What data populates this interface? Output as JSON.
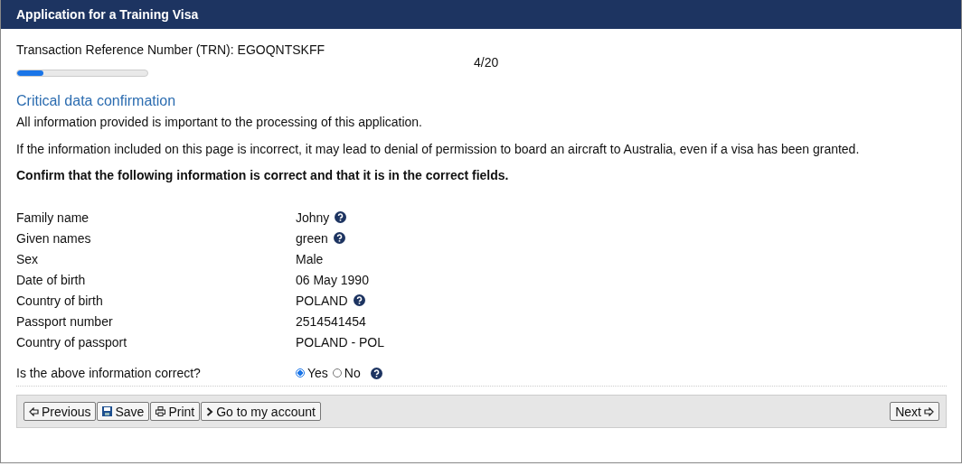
{
  "window": {
    "title": "Application for a Training Visa"
  },
  "trn": "Transaction Reference Number (TRN): EGOQNTSKFF",
  "progress": {
    "label": "4/20",
    "level": 0.2
  },
  "section": {
    "heading": "Critical data confirmation",
    "paragraphs": [
      "All information provided is important to the processing of this application.",
      "If the information included on this page is incorrect, it may lead to denial of permission to board an aircraft to Australia, even if a visa has been granted."
    ],
    "instruction": "Confirm that the following information is correct and that it is in the correct fields."
  },
  "fields": [
    {
      "label": "Family name",
      "value": "Johny",
      "help": true
    },
    {
      "label": "Given names",
      "value": "green",
      "help": true
    },
    {
      "label": "Sex",
      "value": "Male",
      "help": false
    },
    {
      "label": "Date of birth",
      "value": "06 May 1990",
      "help": false
    },
    {
      "label": "Country of birth",
      "value": "POLAND",
      "help": true
    },
    {
      "label": "Passport number",
      "value": "2514541454",
      "help": false
    },
    {
      "label": "Country of passport",
      "value": "POLAND - POL",
      "help": false
    }
  ],
  "question": {
    "label": "Is the above information correct?",
    "help": true,
    "options": [
      {
        "label": "Yes",
        "selected": true
      },
      {
        "label": "No",
        "selected": false
      }
    ]
  },
  "buttons": [
    {
      "label": "Previous",
      "kind": "previous"
    },
    {
      "label": "Save",
      "kind": "save"
    },
    {
      "label": "Print",
      "kind": "print"
    },
    {
      "label": "Go to my account",
      "kind": "account"
    },
    {
      "label": "Next",
      "kind": "next"
    }
  ]
}
